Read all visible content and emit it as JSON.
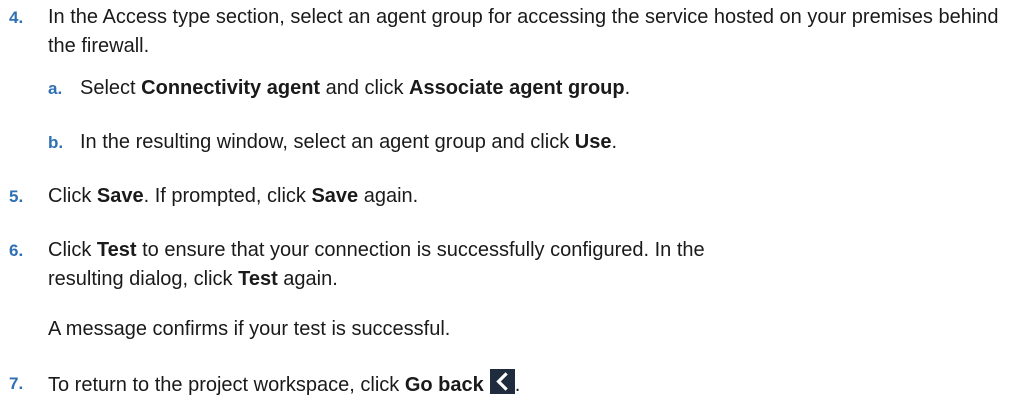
{
  "steps": [
    {
      "number": "4.",
      "text": "In the Access type section, select an agent group for accessing the service hosted on your premises behind the firewall.",
      "substeps": [
        {
          "letter": "a.",
          "t1": "Select ",
          "b1": "Connectivity agent",
          "t2": " and click ",
          "b2": "Associate agent group",
          "t3": "."
        },
        {
          "letter": "b.",
          "t1": "In the resulting window, select an agent group and click ",
          "b1": "Use",
          "t2": "."
        }
      ]
    },
    {
      "number": "5.",
      "t1": "Click ",
      "b1": "Save",
      "t2": ". If prompted, click ",
      "b2": "Save",
      "t3": " again."
    },
    {
      "number": "6.",
      "t1": "Click ",
      "b1": "Test",
      "t2": " to ensure that your connection is successfully configured. In the resulting dialog, click ",
      "b2": "Test",
      "t3": " again.",
      "note": "A message confirms if your test is successful."
    },
    {
      "number": "7.",
      "t1": "To return to the project workspace, click ",
      "b1": "Go back",
      "t2": ".",
      "icon": "chevron-left-icon"
    }
  ]
}
